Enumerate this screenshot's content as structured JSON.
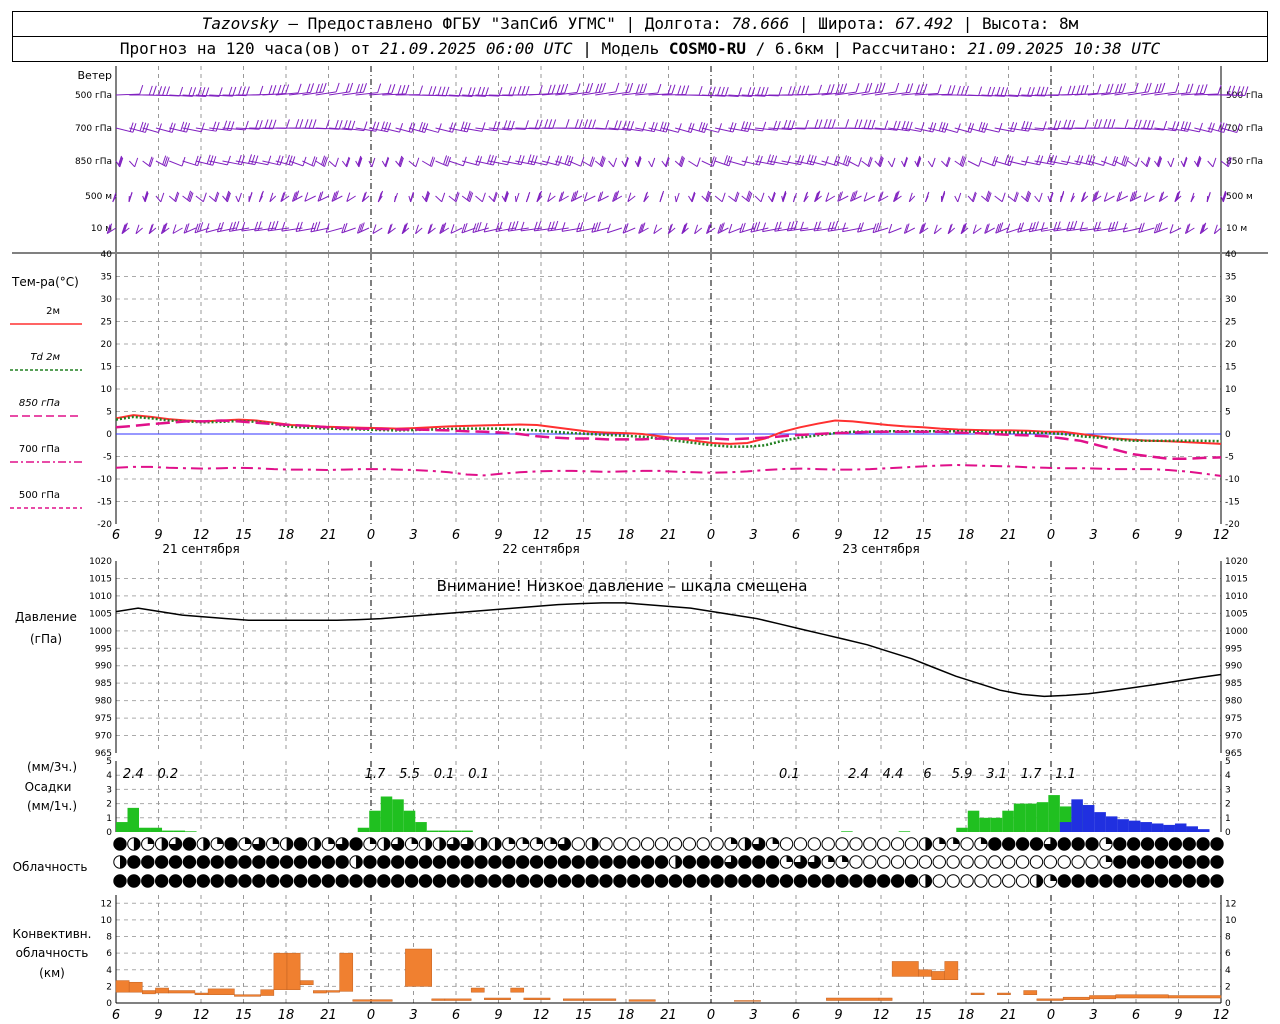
{
  "header": {
    "line1": [
      "Tazovsky",
      " – Предоставлено ФГБУ \"ЗапСиб УГМС\" | Долгота: ",
      "78.666",
      " | Широта: ",
      "67.492",
      " | Высота: 8м"
    ],
    "line2": [
      "Прогноз на 120 часа(ов) от ",
      "21.09.2025 06:00 UTC",
      " | Модель ",
      "COSMO-RU",
      " / 6.6км | Рассчитано: ",
      "21.09.2025 10:38 UTC"
    ]
  },
  "chart_data": {
    "type": "meteogram",
    "x": {
      "hour_labels": [
        "6",
        "9",
        "12",
        "15",
        "18",
        "21",
        "0",
        "3",
        "6",
        "9",
        "12",
        "15",
        "18",
        "21",
        "0",
        "3",
        "6",
        "9",
        "12",
        "15",
        "18",
        "21",
        "0",
        "3",
        "6",
        "9",
        "12"
      ],
      "day_labels": [
        "21 сентября",
        "22 сентября",
        "23 сентября"
      ]
    },
    "wind": {
      "title": "Ветер",
      "levels": [
        "500 гПа",
        "700 гПа",
        "850 гПа",
        "500 м",
        "10 м"
      ]
    },
    "temperature": {
      "title": "Тем-ра(°С)",
      "ylim": [
        -20,
        40
      ],
      "ticks": [
        "40",
        "35",
        "30",
        "25",
        "20",
        "15",
        "10",
        "5",
        "0",
        "-5",
        "-10",
        "-15",
        "-20"
      ],
      "series": [
        {
          "name": "2м",
          "color": "#ff3030",
          "style": "solid",
          "values": [
            3.5,
            4.2,
            3.8,
            3.3,
            3.0,
            2.8,
            3.0,
            3.2,
            3.0,
            2.5,
            2.0,
            1.8,
            1.6,
            1.5,
            1.4,
            1.3,
            1.2,
            1.3,
            1.5,
            1.7,
            1.8,
            1.9,
            2.0,
            2.1,
            2.0,
            1.5,
            1.0,
            0.5,
            0.3,
            0.2,
            0.0,
            -0.5,
            -1.0,
            -1.5,
            -2.0,
            -2.2,
            -2.0,
            -1.0,
            0.5,
            1.5,
            2.3,
            3.0,
            2.8,
            2.4,
            2.0,
            1.7,
            1.5,
            1.2,
            1.0,
            0.9,
            0.8,
            0.8,
            0.7,
            0.5,
            0.5,
            0.0,
            -0.5,
            -1.0,
            -1.3,
            -1.5,
            -1.6,
            -1.8,
            -2.0,
            -2.2
          ]
        },
        {
          "name": "Td 2м",
          "color": "#208020",
          "style": "dotted",
          "values": [
            3.2,
            3.8,
            3.5,
            3.0,
            2.8,
            2.6,
            2.7,
            2.9,
            2.7,
            2.2,
            1.6,
            1.4,
            1.2,
            1.1,
            1.0,
            0.9,
            0.8,
            0.9,
            1.0,
            1.1,
            1.2,
            1.2,
            1.2,
            1.0,
            0.8,
            0.5,
            0.2,
            0.0,
            -0.2,
            -0.4,
            -0.6,
            -1.0,
            -1.5,
            -2.0,
            -2.5,
            -2.8,
            -2.8,
            -2.5,
            -1.5,
            -0.8,
            -0.3,
            0.2,
            0.5,
            0.5,
            0.6,
            0.6,
            0.6,
            0.6,
            0.6,
            0.5,
            0.4,
            0.4,
            0.3,
            0.2,
            0.0,
            -0.5,
            -0.8,
            -1.2,
            -1.5,
            -1.5,
            -1.5,
            -1.5,
            -1.5,
            -1.6
          ]
        },
        {
          "name": "850 гПа",
          "color": "#e0108a",
          "style": "dashed",
          "values": [
            1.5,
            1.8,
            2.2,
            2.5,
            2.8,
            2.8,
            3.0,
            2.8,
            2.5,
            2.2,
            2.0,
            1.8,
            1.5,
            1.3,
            1.2,
            1.1,
            1.0,
            1.0,
            0.9,
            0.8,
            0.6,
            0.5,
            0.3,
            0.0,
            -0.5,
            -0.8,
            -1.0,
            -1.0,
            -1.2,
            -1.2,
            -1.2,
            -1.0,
            -1.0,
            -1.0,
            -1.0,
            -1.2,
            -1.0,
            -0.8,
            -0.5,
            -0.2,
            0.0,
            0.2,
            0.3,
            0.5,
            0.5,
            0.5,
            0.5,
            0.5,
            0.3,
            0.2,
            0.0,
            -0.2,
            -0.3,
            -0.5,
            -1.0,
            -1.5,
            -2.5,
            -3.5,
            -4.5,
            -5.0,
            -5.5,
            -5.5,
            -5.3,
            -5.2
          ]
        },
        {
          "name": "700 гПа",
          "color": "#e0108a",
          "style": "dashdot",
          "values": [
            -7.5,
            -7.3,
            -7.3,
            -7.5,
            -7.6,
            -7.7,
            -7.6,
            -7.5,
            -7.6,
            -7.8,
            -7.9,
            -7.9,
            -8.0,
            -7.9,
            -7.8,
            -7.8,
            -7.9,
            -8.0,
            -8.2,
            -8.5,
            -9.0,
            -9.2,
            -8.8,
            -8.5,
            -8.3,
            -8.2,
            -8.2,
            -8.3,
            -8.4,
            -8.3,
            -8.2,
            -8.2,
            -8.4,
            -8.5,
            -8.6,
            -8.5,
            -8.3,
            -8.0,
            -7.8,
            -7.7,
            -7.8,
            -7.9,
            -7.9,
            -7.8,
            -7.6,
            -7.4,
            -7.2,
            -7.0,
            -6.9,
            -7.0,
            -7.1,
            -7.2,
            -7.4,
            -7.5,
            -7.6,
            -7.6,
            -7.7,
            -7.8,
            -7.8,
            -7.8,
            -8.0,
            -8.3,
            -8.8,
            -9.3
          ]
        }
      ]
    },
    "pressure": {
      "title": "Давление",
      "unit": "(гПа)",
      "note": "Внимание! Низкое давление – шкала смещена",
      "ylim": [
        965,
        1020
      ],
      "ticks": [
        "1020",
        "1015",
        "1010",
        "1005",
        "1000",
        "995",
        "990",
        "985",
        "980",
        "975",
        "970",
        "965"
      ],
      "values": [
        1005.5,
        1006.5,
        1005.5,
        1004.5,
        1004,
        1003.5,
        1003,
        1003,
        1003,
        1003,
        1003,
        1003.2,
        1003.5,
        1004,
        1004.5,
        1005,
        1005.5,
        1006,
        1006.5,
        1007,
        1007.5,
        1007.8,
        1008,
        1008,
        1007.5,
        1007,
        1006.5,
        1005.5,
        1004.5,
        1003.5,
        1002,
        1000.5,
        999,
        997.5,
        996,
        994,
        992,
        989.5,
        987,
        985,
        983,
        981.8,
        981.2,
        981.5,
        982,
        982.8,
        983.7,
        984.6,
        985.6,
        986.6,
        987.5
      ]
    },
    "precip": {
      "title_3h": "(мм/3ч.)",
      "title": "Осадки",
      "title_1h": "(мм/1ч.)",
      "ylim": [
        0,
        5
      ],
      "ticks": [
        "5",
        "4",
        "3",
        "2",
        "1",
        "0"
      ],
      "labels_3h": [
        {
          "i": 0,
          "v": "2.4"
        },
        {
          "i": 1,
          "v": "0.2"
        },
        {
          "i": 7,
          "v": "1.7"
        },
        {
          "i": 8,
          "v": "5.5"
        },
        {
          "i": 9,
          "v": "0.1"
        },
        {
          "i": 10,
          "v": "0.1"
        },
        {
          "i": 19,
          "v": "0.1"
        },
        {
          "i": 21,
          "v": "2.4"
        },
        {
          "i": 22,
          "v": "4.4"
        },
        {
          "i": 23,
          "v": "6"
        },
        {
          "i": 24,
          "v": "5.9"
        },
        {
          "i": 25,
          "v": "3.1"
        },
        {
          "i": 26,
          "v": "1.7"
        },
        {
          "i": 27,
          "v": "1.1"
        }
      ],
      "rain_1h": [
        0.7,
        1.7,
        0.3,
        0.3,
        0.1,
        0.1,
        0.05,
        0,
        0,
        0,
        0,
        0,
        0,
        0,
        0,
        0,
        0,
        0,
        0,
        0,
        0,
        0.3,
        1.5,
        2.5,
        2.3,
        1.5,
        0.7,
        0.1,
        0.1,
        0.1,
        0.1,
        0,
        0,
        0,
        0,
        0,
        0,
        0,
        0,
        0,
        0,
        0,
        0,
        0,
        0,
        0,
        0,
        0,
        0,
        0,
        0,
        0,
        0,
        0,
        0,
        0,
        0,
        0,
        0,
        0,
        0,
        0,
        0,
        0.05,
        0,
        0,
        0,
        0,
        0.05,
        0,
        0,
        0,
        0,
        0.3,
        1.5,
        1.0,
        1.0,
        1.5,
        2.0,
        2.0,
        2.1,
        2.6,
        1.8,
        2.0
      ],
      "snow_1h": [
        0,
        0,
        0,
        0,
        0,
        0,
        0,
        0,
        0,
        0,
        0,
        0,
        0,
        0,
        0,
        0,
        0,
        0,
        0,
        0,
        0,
        0,
        0,
        0,
        0,
        0,
        0,
        0,
        0,
        0,
        0,
        0,
        0,
        0,
        0,
        0,
        0,
        0,
        0,
        0,
        0,
        0,
        0,
        0,
        0,
        0,
        0,
        0,
        0,
        0,
        0,
        0,
        0,
        0,
        0,
        0,
        0,
        0,
        0,
        0,
        0,
        0,
        0,
        0,
        0,
        0,
        0,
        0,
        0,
        0,
        0,
        0,
        0,
        0,
        0,
        0,
        0,
        0,
        0,
        0,
        0,
        0,
        0.7,
        2.3,
        1.9,
        1.4,
        1.1,
        0.9,
        0.8,
        0.7,
        0.6,
        0.5,
        0.6,
        0.4,
        0.2
      ]
    },
    "cloud": {
      "title": "Облачность",
      "rows": [
        "fhqhtfhqfqtqhfhqtfqhtqhhtthhqqqqtohoooooooooqhtqoooooooooohqqoqfffftfffqfffffffftffffhhffffffffoooo",
        "hffffffffffffffffhffffffffffffffffffffffhffftfffqttqqooooooooooooooooooqfffffffffffffffffffffffffffffff",
        "ffffffffffffffffffffffffffffffffffffffffffffffffffffffffffhooooooohqffffffffffffffffffffffffffffffffffffffff"
      ]
    },
    "convective": {
      "title": "Конвективн.",
      "title2": "облачность",
      "unit": "(км)",
      "ylim": [
        0,
        13
      ],
      "ticks": [
        "12",
        "10",
        "8",
        "6",
        "4",
        "2",
        "0"
      ],
      "bars": [
        {
          "x0": 0,
          "x1": 1,
          "lo": 1.3,
          "hi": 2.7
        },
        {
          "x0": 1,
          "x1": 2,
          "lo": 1.3,
          "hi": 2.5
        },
        {
          "x0": 2,
          "x1": 3,
          "lo": 1.1,
          "hi": 1.5
        },
        {
          "x0": 3,
          "x1": 4,
          "lo": 1.2,
          "hi": 1.8
        },
        {
          "x0": 4,
          "x1": 6,
          "lo": 1.2,
          "hi": 1.5
        },
        {
          "x0": 6,
          "x1": 7,
          "lo": 1.0,
          "hi": 1.2
        },
        {
          "x0": 7,
          "x1": 9,
          "lo": 1.0,
          "hi": 1.7
        },
        {
          "x0": 9,
          "x1": 11,
          "lo": 0.8,
          "hi": 1.0
        },
        {
          "x0": 11,
          "x1": 12,
          "lo": 0.9,
          "hi": 1.6
        },
        {
          "x0": 12,
          "x1": 13,
          "lo": 1.6,
          "hi": 6.0
        },
        {
          "x0": 13,
          "x1": 14,
          "lo": 1.6,
          "hi": 6.0
        },
        {
          "x0": 14,
          "x1": 15,
          "lo": 2.2,
          "hi": 2.7
        },
        {
          "x0": 15,
          "x1": 16,
          "lo": 1.2,
          "hi": 1.5
        },
        {
          "x0": 16,
          "x1": 17,
          "lo": 1.3,
          "hi": 1.5
        },
        {
          "x0": 17,
          "x1": 18,
          "lo": 1.4,
          "hi": 6.0
        },
        {
          "x0": 18,
          "x1": 21,
          "lo": 0.2,
          "hi": 0.4
        },
        {
          "x0": 22,
          "x1": 24,
          "lo": 2.0,
          "hi": 6.5
        },
        {
          "x0": 24,
          "x1": 25,
          "lo": 0.3,
          "hi": 0.5
        },
        {
          "x0": 25,
          "x1": 27,
          "lo": 0.3,
          "hi": 0.5
        },
        {
          "x0": 27,
          "x1": 28,
          "lo": 1.3,
          "hi": 1.8
        },
        {
          "x0": 28,
          "x1": 30,
          "lo": 0.4,
          "hi": 0.6
        },
        {
          "x0": 30,
          "x1": 31,
          "lo": 1.3,
          "hi": 1.8
        },
        {
          "x0": 31,
          "x1": 33,
          "lo": 0.4,
          "hi": 0.6
        },
        {
          "x0": 34,
          "x1": 38,
          "lo": 0.3,
          "hi": 0.5
        },
        {
          "x0": 39,
          "x1": 41,
          "lo": 0.2,
          "hi": 0.4
        },
        {
          "x0": 47,
          "x1": 49,
          "lo": 0.2,
          "hi": 0.3
        },
        {
          "x0": 54,
          "x1": 58,
          "lo": 0.3,
          "hi": 0.6
        },
        {
          "x0": 58,
          "x1": 59,
          "lo": 0.3,
          "hi": 0.6
        },
        {
          "x0": 59,
          "x1": 61,
          "lo": 3.2,
          "hi": 5.0
        },
        {
          "x0": 61,
          "x1": 62,
          "lo": 3.2,
          "hi": 4.0
        },
        {
          "x0": 62,
          "x1": 63,
          "lo": 2.8,
          "hi": 3.8
        },
        {
          "x0": 63,
          "x1": 64,
          "lo": 2.8,
          "hi": 5.0
        },
        {
          "x0": 65,
          "x1": 66,
          "lo": 1.0,
          "hi": 1.2
        },
        {
          "x0": 67,
          "x1": 68,
          "lo": 1.0,
          "hi": 1.2
        },
        {
          "x0": 69,
          "x1": 70,
          "lo": 1.0,
          "hi": 1.5
        },
        {
          "x0": 70,
          "x1": 72,
          "lo": 0.3,
          "hi": 0.5
        },
        {
          "x0": 72,
          "x1": 74,
          "lo": 0.4,
          "hi": 0.7
        },
        {
          "x0": 74,
          "x1": 76,
          "lo": 0.5,
          "hi": 0.9
        },
        {
          "x0": 76,
          "x1": 80,
          "lo": 0.6,
          "hi": 1.0
        },
        {
          "x0": 80,
          "x1": 84,
          "lo": 0.6,
          "hi": 0.9
        }
      ]
    }
  }
}
